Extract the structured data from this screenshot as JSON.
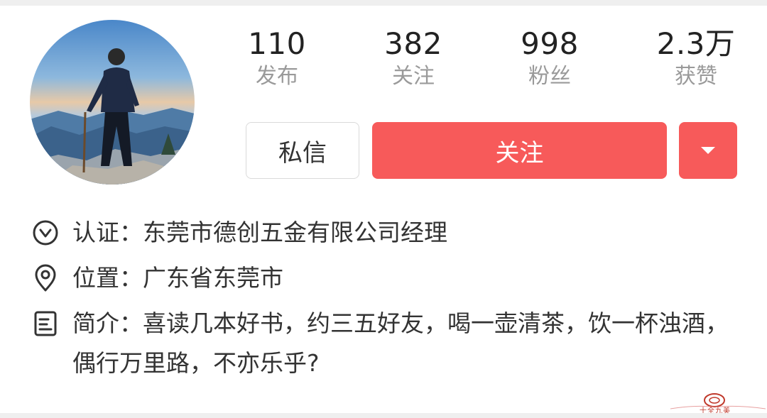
{
  "profile": {
    "avatar": "profile-photo-man-on-mountain"
  },
  "stats": {
    "posts": {
      "value": "110",
      "label": "发布"
    },
    "following": {
      "value": "382",
      "label": "关注"
    },
    "fans": {
      "value": "998",
      "label": "粉丝"
    },
    "likes": {
      "value": "2.3万",
      "label": "获赞"
    }
  },
  "actions": {
    "message_label": "私信",
    "follow_label": "关注",
    "more_icon": "caret-down-icon"
  },
  "info": {
    "verification": {
      "icon": "check-circle-icon",
      "text": "认证：东莞市德创五金有限公司经理"
    },
    "location": {
      "icon": "location-pin-icon",
      "text": "位置：广东省东莞市"
    },
    "bio": {
      "icon": "document-icon",
      "text": "简介：喜读几本好书，约三五好友，喝一壶清茶，饮一杯浊酒，偶行万里路，不亦乐乎?"
    }
  },
  "watermark": {
    "text": "十全九美"
  },
  "colors": {
    "accent": "#f75a5a",
    "label_gray": "#9a9a9a",
    "text_dark": "#333333"
  }
}
